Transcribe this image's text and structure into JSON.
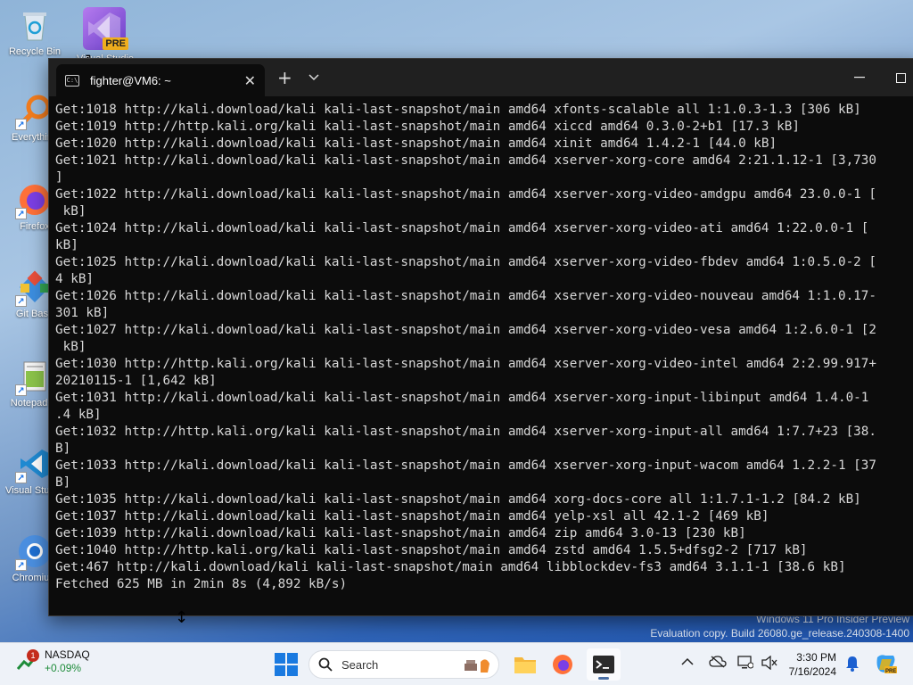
{
  "desktop": {
    "icons": [
      {
        "name": "recycle-bin",
        "label": "Recycle Bin"
      },
      {
        "name": "everything",
        "label": "Everything"
      },
      {
        "name": "firefox",
        "label": "Firefox"
      },
      {
        "name": "git-bash",
        "label": "Git Bash"
      },
      {
        "name": "notepad",
        "label": "Notepad++"
      },
      {
        "name": "vscode",
        "label": "Visual Studio Code"
      },
      {
        "name": "chromium",
        "label": "Chromium"
      }
    ],
    "vs_preview": {
      "label": "Visual Studio",
      "badge": "PRE"
    },
    "watermark": {
      "line1": "Windows 11 Pro Insider Preview",
      "line2": "Evaluation copy. Build 26080.ge_release.240308-1400"
    }
  },
  "terminal": {
    "tab_title": "fighter@VM6: ~",
    "tab_close": "✕",
    "new_tab": "+",
    "dropdown": "⌄",
    "minimize": "—",
    "maximize": "☐",
    "lines": [
      "Get:1018 http://kali.download/kali kali-last-snapshot/main amd64 xfonts-scalable all 1:1.0.3-1.3 [306 kB]",
      "Get:1019 http://http.kali.org/kali kali-last-snapshot/main amd64 xiccd amd64 0.3.0-2+b1 [17.3 kB]",
      "Get:1020 http://kali.download/kali kali-last-snapshot/main amd64 xinit amd64 1.4.2-1 [44.0 kB]",
      "Get:1021 http://kali.download/kali kali-last-snapshot/main amd64 xserver-xorg-core amd64 2:21.1.12-1 [3,730",
      "]",
      "Get:1022 http://kali.download/kali kali-last-snapshot/main amd64 xserver-xorg-video-amdgpu amd64 23.0.0-1 [",
      " kB]",
      "Get:1024 http://kali.download/kali kali-last-snapshot/main amd64 xserver-xorg-video-ati amd64 1:22.0.0-1 [",
      "kB]",
      "Get:1025 http://kali.download/kali kali-last-snapshot/main amd64 xserver-xorg-video-fbdev amd64 1:0.5.0-2 [",
      "4 kB]",
      "Get:1026 http://kali.download/kali kali-last-snapshot/main amd64 xserver-xorg-video-nouveau amd64 1:1.0.17-",
      "301 kB]",
      "Get:1027 http://kali.download/kali kali-last-snapshot/main amd64 xserver-xorg-video-vesa amd64 1:2.6.0-1 [2",
      " kB]",
      "Get:1030 http://http.kali.org/kali kali-last-snapshot/main amd64 xserver-xorg-video-intel amd64 2:2.99.917+",
      "20210115-1 [1,642 kB]",
      "Get:1031 http://kali.download/kali kali-last-snapshot/main amd64 xserver-xorg-input-libinput amd64 1.4.0-1",
      ".4 kB]",
      "Get:1032 http://http.kali.org/kali kali-last-snapshot/main amd64 xserver-xorg-input-all amd64 1:7.7+23 [38.",
      "B]",
      "Get:1033 http://kali.download/kali kali-last-snapshot/main amd64 xserver-xorg-input-wacom amd64 1.2.2-1 [37",
      "B]",
      "Get:1035 http://kali.download/kali kali-last-snapshot/main amd64 xorg-docs-core all 1:1.7.1-1.2 [84.2 kB]",
      "Get:1037 http://kali.download/kali kali-last-snapshot/main amd64 yelp-xsl all 42.1-2 [469 kB]",
      "Get:1039 http://kali.download/kali kali-last-snapshot/main amd64 zip amd64 3.0-13 [230 kB]",
      "Get:1040 http://http.kali.org/kali kali-last-snapshot/main amd64 zstd amd64 1.5.5+dfsg2-2 [717 kB]",
      "Get:467 http://kali.download/kali kali-last-snapshot/main amd64 libblockdev-fs3 amd64 3.1.1-1 [38.6 kB]",
      "Fetched 625 MB in 2min 8s (4,892 kB/s)"
    ]
  },
  "taskbar": {
    "widget": {
      "name": "NASDAQ",
      "change": "+0.09%",
      "badge": "1"
    },
    "search_placeholder": "Search",
    "clock": {
      "time": "3:30 PM",
      "date": "7/16/2024"
    },
    "colors": {
      "positive": "#1e8c3a",
      "badge": "#c42b1c"
    }
  }
}
